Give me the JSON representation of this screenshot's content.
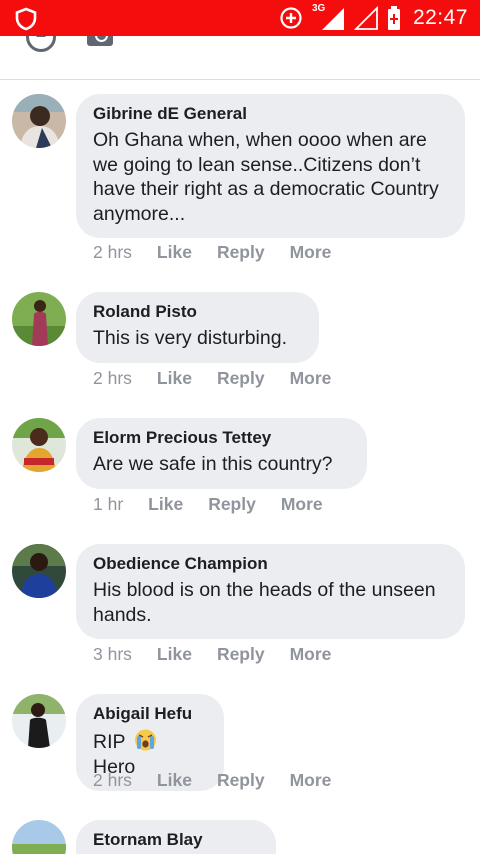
{
  "status_bar": {
    "time": "22:47",
    "network": "3G",
    "background_color": "#f50d0d"
  },
  "colors": {
    "bubble": "#ebedf0",
    "meta_text": "#90949c",
    "name_text": "#1c1e21"
  },
  "actions": {
    "like": "Like",
    "reply": "Reply",
    "more": "More"
  },
  "comments": [
    {
      "author": "Gibrine dE General",
      "text": "Oh Ghana when, when oooo when are we going to lean sense..Citizens don’t have their right as a democratic Country anymore...",
      "time": "2 hrs"
    },
    {
      "author": "Roland Pisto",
      "text": "This is very disturbing.",
      "time": "2 hrs"
    },
    {
      "author": "Elorm Precious Tettey",
      "text": "Are we safe in this country?",
      "time": "1 hr"
    },
    {
      "author": "Obedience Champion",
      "text": "His blood is on the heads of the unseen hands.",
      "time": "3 hrs"
    },
    {
      "author": "Abigail Hefu",
      "text": "RIP",
      "text_after_emoji": "Hero",
      "emoji": "crying-face-emoji",
      "time": "2 hrs"
    },
    {
      "author": "Etornam Blay Dornyo"
    }
  ]
}
